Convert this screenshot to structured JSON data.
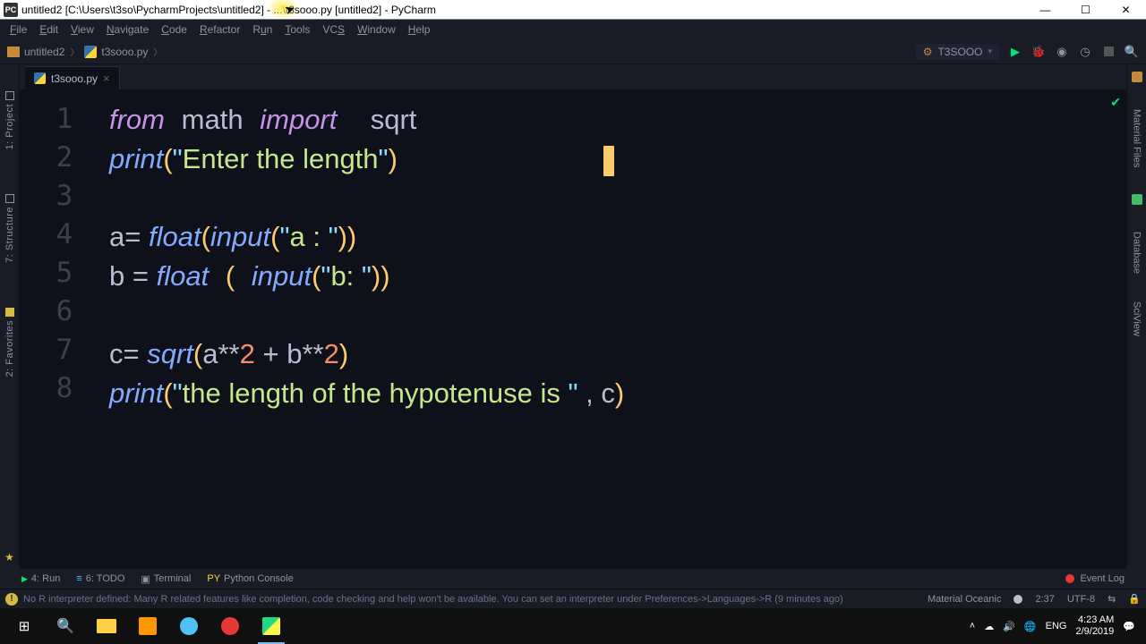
{
  "window": {
    "title": "untitled2 [C:\\Users\\t3so\\PycharmProjects\\untitled2] - ...\\t3sooo.py [untitled2] - PyCharm"
  },
  "menu": [
    "File",
    "Edit",
    "View",
    "Navigate",
    "Code",
    "Refactor",
    "Run",
    "Tools",
    "VCS",
    "Window",
    "Help"
  ],
  "breadcrumb": {
    "project": "untitled2",
    "file": "t3sooo.py"
  },
  "toolbar": {
    "config": "T3SOOO"
  },
  "tab": {
    "name": "t3sooo.py"
  },
  "left_panels": [
    "1: Project",
    "7: Structure",
    "2: Favorites"
  ],
  "right_panels": [
    "Material Files",
    "Database",
    "SciView"
  ],
  "code": {
    "lines": [
      "1",
      "2",
      "3",
      "4",
      "5",
      "6",
      "7",
      "8"
    ],
    "l1_from": "from",
    "l1_math": "math",
    "l1_import": "import",
    "l1_sqrt": "sqrt",
    "l2_print": "print",
    "l2_str": "Enter the length",
    "l4": "a= ",
    "l4_float": "float",
    "l4_input": "input",
    "l4_str": "a : ",
    "l5": "b = ",
    "l5_float": "float",
    "l5_input": "input",
    "l5_str": "b: ",
    "l7": "c= ",
    "l7_sqrt": "sqrt",
    "l7_a": "a**",
    "l7_2a": "2",
    "l7_plus": " + ",
    "l7_b": "b**",
    "l7_2b": "2",
    "l8_print": "print",
    "l8_str": "the length of the hypotenuse is ",
    "l8_comma": " , c"
  },
  "bottom": {
    "run": "4: Run",
    "todo": "6: TODO",
    "terminal": "Terminal",
    "console": "Python Console",
    "eventlog": "Event Log"
  },
  "status": {
    "msg": "No R interpreter defined: Many R related features like completion, code checking and help won't be available. You can set an interpreter under Preferences->Languages->R (9 minutes ago)",
    "theme": "Material Oceanic",
    "pos": "2:37",
    "enc": "UTF-8",
    "br": "⇆"
  },
  "tray": {
    "lang": "ENG",
    "time": "4:23 AM",
    "date": "2/9/2019"
  }
}
